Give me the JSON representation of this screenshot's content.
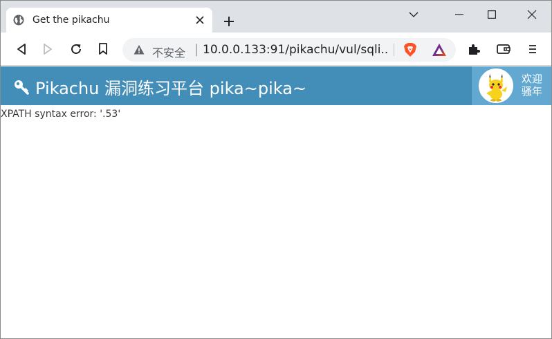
{
  "browser": {
    "tab_title": "Get the pikachu",
    "address_bar": {
      "security_label": "不安全",
      "separator": "|",
      "url": "10.0.0.133:91/pikachu/vul/sqli..."
    },
    "icons": [
      "globe-icon",
      "close-icon",
      "plus-icon",
      "chevron-down-icon",
      "minimize-icon",
      "maximize-icon",
      "window-close-icon",
      "back-icon",
      "forward-icon",
      "reload-icon",
      "bookmark-icon",
      "warning-icon",
      "brave-shields-icon",
      "brave-rewards-icon",
      "extensions-icon",
      "wallet-icon",
      "menu-icon"
    ]
  },
  "page": {
    "navbar": {
      "brand_text": "Pikachu 漏洞练习平台 pika~pika~",
      "welcome_line1": "欢迎",
      "welcome_line2": "骚年",
      "accent_color": "#438eb9",
      "user_bg_color": "#62a8d1"
    },
    "error_message": "XPATH syntax error: '.53'"
  }
}
